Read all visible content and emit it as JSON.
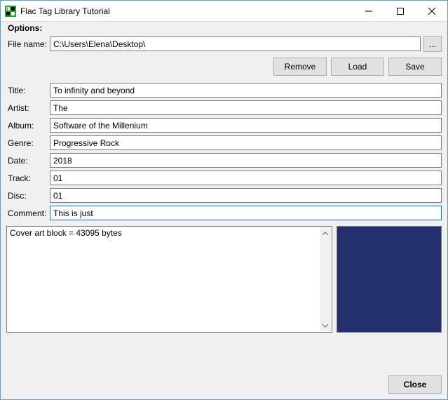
{
  "window": {
    "title": "Flac Tag Library Tutorial"
  },
  "options_label": "Options:",
  "labels": {
    "file_name": "File name:",
    "title": "Title:",
    "artist": "Artist:",
    "album": "Album:",
    "genre": "Genre:",
    "date": "Date:",
    "track": "Track:",
    "disc": "Disc:",
    "comment": "Comment:"
  },
  "values": {
    "file_name": "C:\\Users\\Elena\\Desktop\\",
    "title": "To infinity and beyond",
    "artist": "The",
    "album": "Software of the Millenium",
    "genre": "Progressive Rock",
    "date": "2018",
    "track": "01",
    "disc": "01",
    "comment": "This is just"
  },
  "buttons": {
    "browse": "...",
    "remove": "Remove",
    "load": "Load",
    "save": "Save",
    "close": "Close"
  },
  "metadata_text": "Cover art block = 43095 bytes",
  "colors": {
    "cover_bg": "#24306e"
  }
}
